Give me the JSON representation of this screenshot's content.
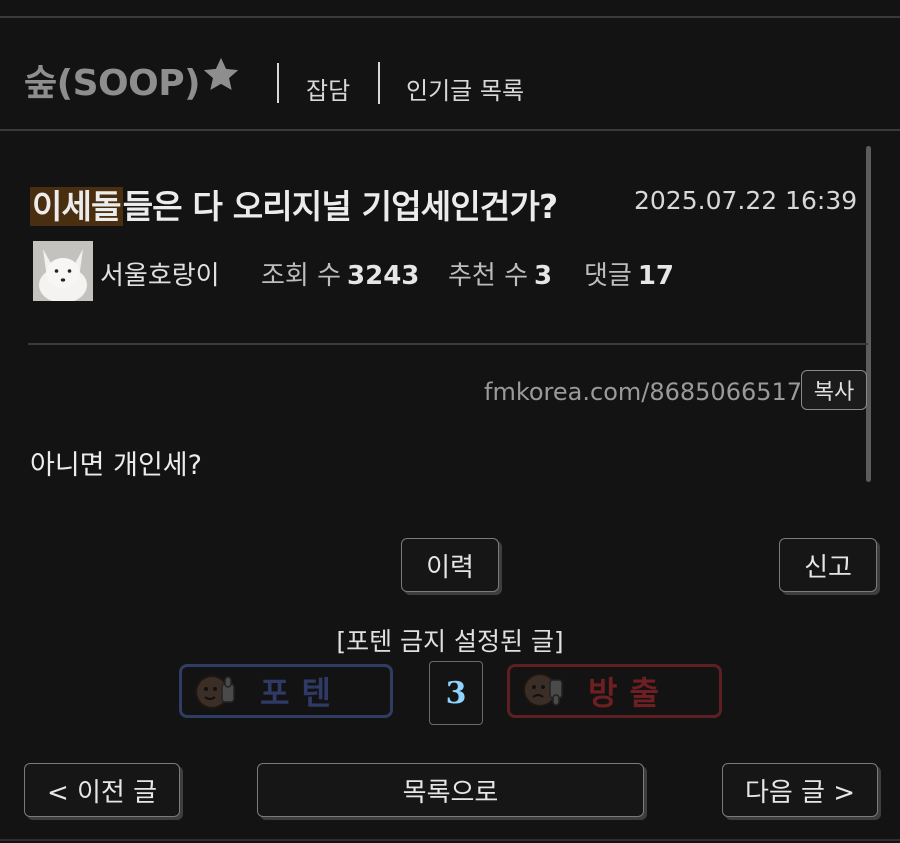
{
  "header": {
    "board_name": "숲(SOOP)",
    "star_icon": "star-icon",
    "nav": [
      {
        "label": "잡담"
      },
      {
        "label": "인기글 목록"
      }
    ]
  },
  "post": {
    "title_highlight": "이세돌",
    "title_rest": "들은 다 오리지널 기업세인건가?",
    "date": "2025.07.22 16:39",
    "author": "서울호랑이",
    "avatar": "white-fox-avatar",
    "stats": {
      "views_label": "조회 수",
      "views": "3243",
      "recommend_label": "추천 수",
      "recommend": "3",
      "comments_label": "댓글",
      "comments": "17"
    },
    "url": "fmkorea.com/8685066517",
    "copy_label": "복사",
    "body": "아니면 개인세?"
  },
  "actions": {
    "history_label": "이력",
    "report_label": "신고",
    "pot_notice": "[포텐 금지 설정된 글]",
    "vote_up_label": "포텐",
    "vote_count": "3",
    "vote_down_label": "방출"
  },
  "navigation": {
    "prev_label": "< 이전 글",
    "list_label": "목록으로",
    "next_label": "다음 글 >"
  },
  "colors": {
    "background": "#131313",
    "title_highlight_bg": "#4a2e10",
    "vote_up_border": "#2f3d63",
    "vote_down_border": "#5e1f22",
    "vote_count": "#8fd4ff"
  }
}
